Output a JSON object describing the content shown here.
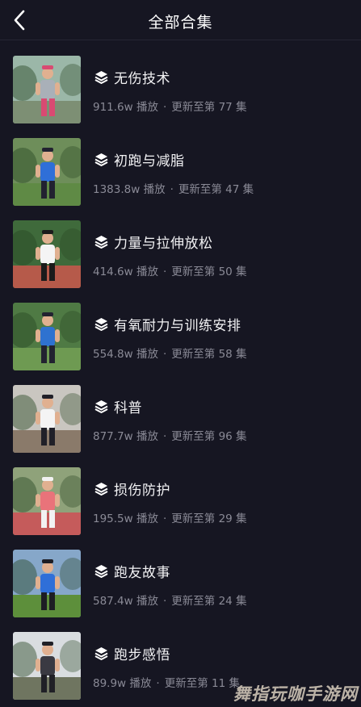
{
  "header": {
    "title": "全部合集"
  },
  "items": [
    {
      "name": "无伤技术",
      "plays": "911.6w 播放",
      "sep": "·",
      "update": "更新至第 77 集",
      "thumb": {
        "sky": "#9bb7a8",
        "ground": "#7d8f74",
        "shirt": "#a9b0b8",
        "accent": "#d94a72"
      }
    },
    {
      "name": "初跑与减脂",
      "plays": "1383.8w 播放",
      "sep": "·",
      "update": "更新至第 47 集",
      "thumb": {
        "sky": "#6e8e5a",
        "ground": "#5f8a45",
        "shirt": "#2f6fd8",
        "accent": "#222230"
      }
    },
    {
      "name": "力量与拉伸放松",
      "plays": "414.6w 播放",
      "sep": "·",
      "update": "更新至第 50 集",
      "thumb": {
        "sky": "#3f6a3b",
        "ground": "#b65a4a",
        "shirt": "#f4f4f4",
        "accent": "#1b1b1b"
      }
    },
    {
      "name": "有氧耐力与训练安排",
      "plays": "554.8w 播放",
      "sep": "·",
      "update": "更新至第 58 集",
      "thumb": {
        "sky": "#4f7a44",
        "ground": "#6e9a52",
        "shirt": "#2f72d0",
        "accent": "#222230"
      }
    },
    {
      "name": "科普",
      "plays": "877.7w 播放",
      "sep": "·",
      "update": "更新至第 96 集",
      "thumb": {
        "sky": "#c9c6c0",
        "ground": "#8a7a6a",
        "shirt": "#f4f4f4",
        "accent": "#202028"
      }
    },
    {
      "name": "损伤防护",
      "plays": "195.5w 播放",
      "sep": "·",
      "update": "更新至第 29 集",
      "thumb": {
        "sky": "#8fa27a",
        "ground": "#c55b5b",
        "shirt": "#e9737a",
        "accent": "#f2f2f2"
      }
    },
    {
      "name": "跑友故事",
      "plays": "587.4w 播放",
      "sep": "·",
      "update": "更新至第 24 集",
      "thumb": {
        "sky": "#86a7c9",
        "ground": "#5d8f3b",
        "shirt": "#2f6fd8",
        "accent": "#1d1d24"
      }
    },
    {
      "name": "跑步感悟",
      "plays": "89.9w 播放",
      "sep": "·",
      "update": "更新至第 11 集",
      "thumb": {
        "sky": "#d9dde0",
        "ground": "#6f7560",
        "shirt": "#3a3a42",
        "accent": "#202026"
      }
    }
  ],
  "watermark": "舞指玩咖手游网",
  "colors": {
    "background": "#161622",
    "title": "#f2f2f4",
    "meta": "#8a8a96"
  }
}
